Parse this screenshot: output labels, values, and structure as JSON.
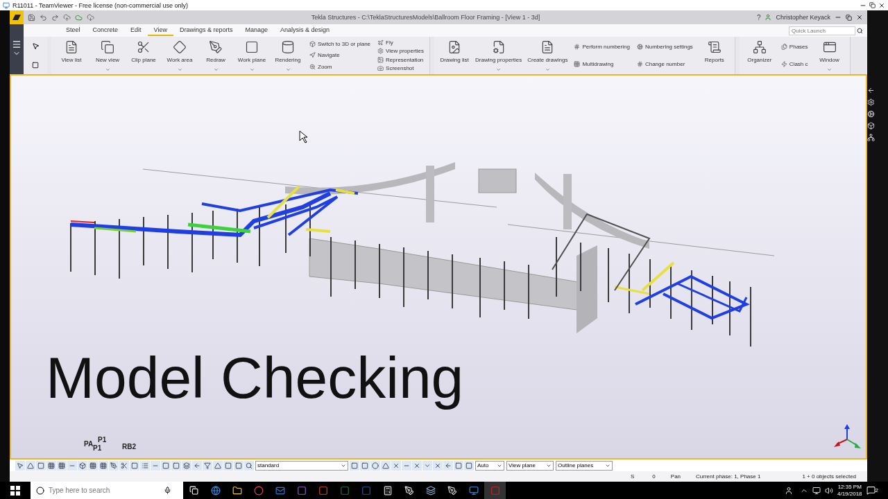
{
  "teamviewer": {
    "title": "R11011 - TeamViewer - Free license (non-commercial use only)"
  },
  "app": {
    "title": "Tekla Structures - C:\\TeklaStructuresModels\\Ballroom Floor Framing  - [View 1 - 3d]",
    "help": "?",
    "user": "Christopher Keyack"
  },
  "tabs": [
    {
      "label": "Steel",
      "selected": false
    },
    {
      "label": "Concrete",
      "selected": false
    },
    {
      "label": "Edit",
      "selected": false
    },
    {
      "label": "View",
      "selected": true
    },
    {
      "label": "Drawings & reports",
      "selected": false
    },
    {
      "label": "Manage",
      "selected": false
    },
    {
      "label": "Analysis & design",
      "selected": false
    }
  ],
  "quick_launch": {
    "placeholder": "Quick Launch"
  },
  "ribbon": [
    {
      "items": [
        {
          "kind": "large",
          "label": "View list",
          "dropdown": false
        },
        {
          "kind": "large",
          "label": "New view",
          "dropdown": true
        },
        {
          "kind": "large",
          "label": "Clip plane",
          "dropdown": false
        },
        {
          "kind": "large",
          "label": "Work area",
          "dropdown": true
        },
        {
          "kind": "large",
          "label": "Redraw",
          "dropdown": true
        },
        {
          "kind": "large",
          "label": "Work plane",
          "dropdown": true
        },
        {
          "kind": "large",
          "label": "Rendering",
          "dropdown": true
        },
        {
          "kind": "stack",
          "entries": [
            "Switch to 3D or plane",
            "Navigate",
            "Zoom"
          ]
        },
        {
          "kind": "stack",
          "entries": [
            "Fly",
            "View properties",
            "Representation",
            "Screenshot"
          ]
        }
      ]
    },
    {
      "items": [
        {
          "kind": "large",
          "label": "Drawing list",
          "dropdown": false
        },
        {
          "kind": "large",
          "label": "Drawing properties",
          "dropdown": true
        },
        {
          "kind": "large",
          "label": "Create drawings",
          "dropdown": true
        },
        {
          "kind": "stack",
          "entries": [
            "Perform numbering",
            "Multidrawing"
          ]
        },
        {
          "kind": "stack",
          "entries": [
            "Numbering settings",
            "Change number"
          ]
        },
        {
          "kind": "large",
          "label": "Reports",
          "dropdown": false
        }
      ]
    },
    {
      "items": [
        {
          "kind": "large",
          "label": "Organizer",
          "dropdown": false
        },
        {
          "kind": "stack",
          "entries": [
            "Phases",
            "Clash c"
          ]
        },
        {
          "kind": "large",
          "label": "Window",
          "dropdown": true
        }
      ]
    }
  ],
  "viewport": {
    "overlay_title": "Model Checking",
    "labels": [
      "PA",
      "P1",
      "P1",
      "RB2"
    ]
  },
  "bottom_toolbar": {
    "filter": "standard",
    "selects": [
      "Auto",
      "View plane",
      "Outline planes"
    ]
  },
  "status_bar": [
    "S",
    "0",
    "Pan",
    "Current phase: 1, Phase 1",
    "1 + 0 objects selected"
  ],
  "taskbar": {
    "search": {
      "placeholder": "Type here to search"
    },
    "time": "12:35 PM",
    "date": "4/19/2018",
    "notifications": "2"
  }
}
